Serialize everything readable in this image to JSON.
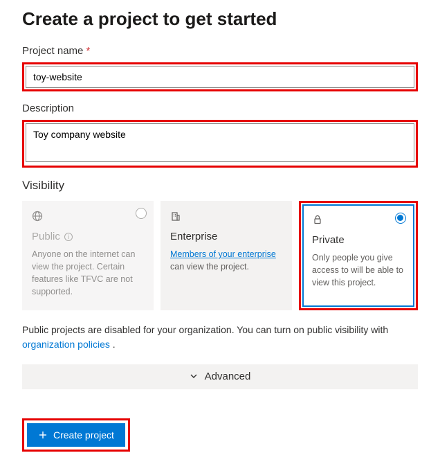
{
  "heading": "Create a project to get started",
  "projectName": {
    "label": "Project name",
    "requiredMark": "*",
    "value": "toy-website"
  },
  "description": {
    "label": "Description",
    "value": "Toy company website"
  },
  "visibility": {
    "label": "Visibility",
    "options": {
      "public": {
        "title": "Public",
        "desc": "Anyone on the internet can view the project. Certain features like TFVC are not supported."
      },
      "enterprise": {
        "title": "Enterprise",
        "descPrefix": "",
        "linkText": "Members of your enterprise",
        "descSuffix": " can view the project."
      },
      "private": {
        "title": "Private",
        "desc": "Only people you give access to will be able to view this project."
      }
    }
  },
  "note": {
    "textBefore": "Public projects are disabled for your organization. You can turn on public visibility with ",
    "linkText": "organization policies",
    "textAfter": " ."
  },
  "advanced": {
    "label": "Advanced"
  },
  "createButton": {
    "label": "Create project"
  }
}
